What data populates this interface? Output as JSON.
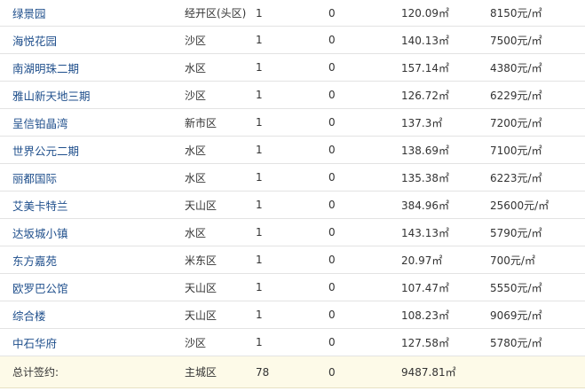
{
  "rows": [
    {
      "name": "绿景园",
      "district": "经开区(头区)",
      "sets": "1",
      "zero": "0",
      "area": "120.09㎡",
      "price": "8150元/㎡"
    },
    {
      "name": "海悦花园",
      "district": "沙区",
      "sets": "1",
      "zero": "0",
      "area": "140.13㎡",
      "price": "7500元/㎡"
    },
    {
      "name": "南湖明珠二期",
      "district": "水区",
      "sets": "1",
      "zero": "0",
      "area": "157.14㎡",
      "price": "4380元/㎡"
    },
    {
      "name": "雅山新天地三期",
      "district": "沙区",
      "sets": "1",
      "zero": "0",
      "area": "126.72㎡",
      "price": "6229元/㎡"
    },
    {
      "name": "呈信铂晶湾",
      "district": "新市区",
      "sets": "1",
      "zero": "0",
      "area": "137.3㎡",
      "price": "7200元/㎡"
    },
    {
      "name": "世界公元二期",
      "district": "水区",
      "sets": "1",
      "zero": "0",
      "area": "138.69㎡",
      "price": "7100元/㎡"
    },
    {
      "name": "丽都国际",
      "district": "水区",
      "sets": "1",
      "zero": "0",
      "area": "135.38㎡",
      "price": "6223元/㎡"
    },
    {
      "name": "艾美卡特兰",
      "district": "天山区",
      "sets": "1",
      "zero": "0",
      "area": "384.96㎡",
      "price": "25600元/㎡"
    },
    {
      "name": "达坂城小镇",
      "district": "水区",
      "sets": "1",
      "zero": "0",
      "area": "143.13㎡",
      "price": "5790元/㎡"
    },
    {
      "name": "东方嘉苑",
      "district": "米东区",
      "sets": "1",
      "zero": "0",
      "area": "20.97㎡",
      "price": "700元/㎡"
    },
    {
      "name": "欧罗巴公馆",
      "district": "天山区",
      "sets": "1",
      "zero": "0",
      "area": "107.47㎡",
      "price": "5550元/㎡"
    },
    {
      "name": "综合楼",
      "district": "天山区",
      "sets": "1",
      "zero": "0",
      "area": "108.23㎡",
      "price": "9069元/㎡"
    },
    {
      "name": "中石华府",
      "district": "沙区",
      "sets": "1",
      "zero": "0",
      "area": "127.58㎡",
      "price": "5780元/㎡"
    }
  ],
  "total": {
    "label": "总计签约:",
    "district": "主城区",
    "sets": "78",
    "zero": "0",
    "area": "9487.81㎡",
    "price": ""
  },
  "colors": {
    "link": "#1f4f8c",
    "total_bg": "#fdfae8",
    "row_border": "#e3e3e3"
  }
}
